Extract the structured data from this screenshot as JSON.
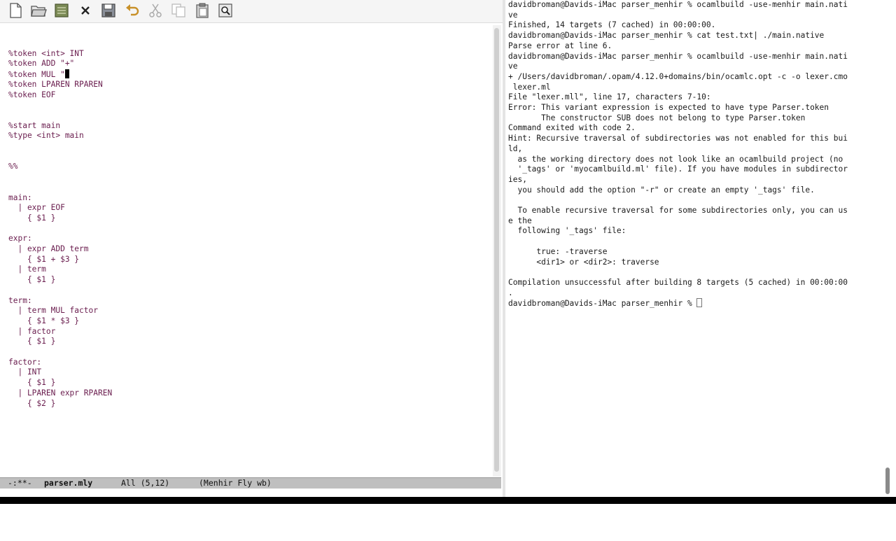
{
  "editor": {
    "toolbar": [
      {
        "icon": "new-file-icon",
        "label": "New file"
      },
      {
        "icon": "open-folder-icon",
        "label": "Open file"
      },
      {
        "icon": "dired-icon",
        "label": "Open directory"
      },
      {
        "icon": "close-icon",
        "label": "Close buffer"
      },
      {
        "icon": "save-icon",
        "label": "Save"
      },
      {
        "icon": "undo-icon",
        "label": "Undo"
      },
      {
        "icon": "cut-icon",
        "label": "Cut"
      },
      {
        "icon": "copy-icon",
        "label": "Copy"
      },
      {
        "icon": "paste-icon",
        "label": "Paste"
      },
      {
        "icon": "search-icon",
        "label": "Search"
      }
    ],
    "lines": [
      "",
      "%token <int> INT",
      "%token ADD \"+\"",
      "%token MUL \"",
      "%token LPAREN RPAREN",
      "%token EOF",
      "",
      "",
      "%start main",
      "%type <int> main",
      "",
      "",
      "%%",
      "",
      "",
      "main:",
      "  | expr EOF",
      "    { $1 }",
      "",
      "expr:",
      "  | expr ADD term",
      "    { $1 + $3 }",
      "  | term",
      "    { $1 }",
      "",
      "term:",
      "  | term MUL factor",
      "    { $1 * $3 }",
      "  | factor",
      "    { $1 }",
      "",
      "factor:",
      "  | INT",
      "    { $1 }",
      "  | LPAREN expr RPAREN",
      "    { $2 }"
    ],
    "cursor_line": 3,
    "modeline": {
      "status": "-:**-",
      "buffer": "parser.mly",
      "position": "All (5,12)",
      "mode": "(Menhir Fly wb)"
    },
    "text_color": "#6a1d4e"
  },
  "terminal": {
    "lines": [
      "davidbroman@Davids-iMac parser_menhir % ocamlbuild -use-menhir main.nati",
      "ve",
      "Finished, 14 targets (7 cached) in 00:00:00.",
      "davidbroman@Davids-iMac parser_menhir % cat test.txt| ./main.native",
      "Parse error at line 6.",
      "davidbroman@Davids-iMac parser_menhir % ocamlbuild -use-menhir main.nati",
      "ve",
      "+ /Users/davidbroman/.opam/4.12.0+domains/bin/ocamlc.opt -c -o lexer.cmo",
      " lexer.ml",
      "File \"lexer.mll\", line 17, characters 7-10:",
      "Error: This variant expression is expected to have type Parser.token",
      "       The constructor SUB does not belong to type Parser.token",
      "Command exited with code 2.",
      "Hint: Recursive traversal of subdirectories was not enabled for this bui",
      "ld,",
      "  as the working directory does not look like an ocamlbuild project (no",
      "  '_tags' or 'myocamlbuild.ml' file). If you have modules in subdirector",
      "ies,",
      "  you should add the option \"-r\" or create an empty '_tags' file.",
      "",
      "  To enable recursive traversal for some subdirectories only, you can us",
      "e the",
      "  following '_tags' file:",
      "",
      "      true: -traverse",
      "      <dir1> or <dir2>: traverse",
      "",
      "Compilation unsuccessful after building 8 targets (5 cached) in 00:00:00",
      ".",
      "davidbroman@Davids-iMac parser_menhir % "
    ]
  }
}
